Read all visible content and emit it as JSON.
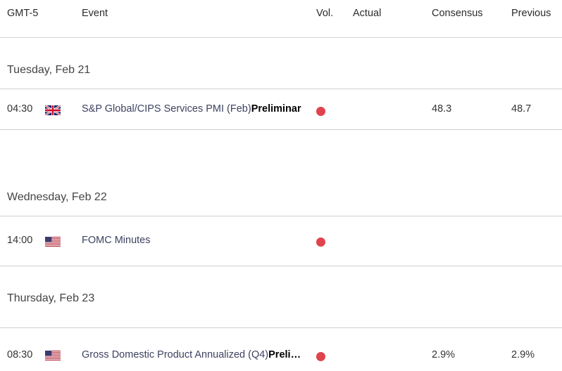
{
  "header": {
    "timezone": "GMT-5",
    "event": "Event",
    "vol": "Vol.",
    "actual": "Actual",
    "consensus": "Consensus",
    "previous": "Previous"
  },
  "colors": {
    "high_volatility": "#e0434d",
    "event_text": "#3d4260"
  },
  "days": [
    {
      "label": "Tuesday, Feb 21",
      "events": [
        {
          "time": "04:30",
          "country_icon": "uk-flag-icon",
          "title": "S&P Global/CIPS Services PMI (Feb)",
          "suffix": "Preliminar",
          "volatility": "high",
          "actual": "",
          "consensus": "48.3",
          "previous": "48.7"
        }
      ]
    },
    {
      "label": "Wednesday, Feb 22",
      "events": [
        {
          "time": "14:00",
          "country_icon": "us-flag-icon",
          "title": "FOMC Minutes",
          "suffix": "",
          "volatility": "high",
          "actual": "",
          "consensus": "",
          "previous": ""
        }
      ]
    },
    {
      "label": "Thursday, Feb 23",
      "events": [
        {
          "time": "08:30",
          "country_icon": "us-flag-icon",
          "title": "Gross Domestic Product Annualized (Q4)",
          "suffix": "Preli…",
          "volatility": "high",
          "actual": "",
          "consensus": "2.9%",
          "previous": "2.9%"
        }
      ]
    }
  ]
}
